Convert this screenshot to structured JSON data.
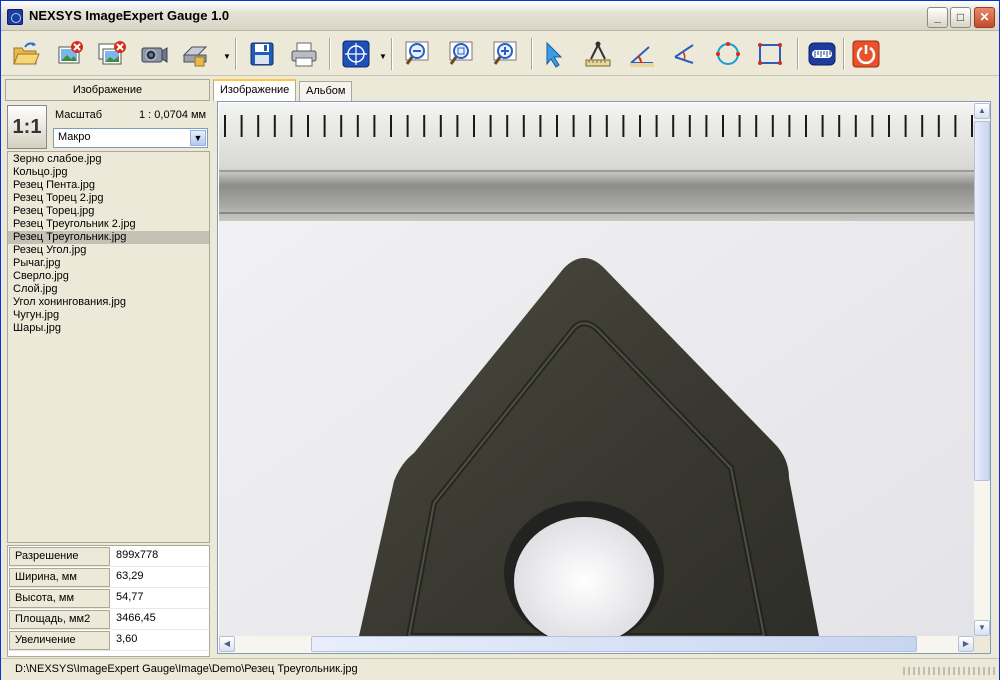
{
  "window": {
    "title": "NEXSYS ImageExpert Gauge 1.0",
    "controls": {
      "minimize": "_",
      "maximize": "□",
      "close": "✕"
    }
  },
  "toolbar": {
    "buttons": [
      {
        "name": "open-folder-icon"
      },
      {
        "name": "close-image-icon"
      },
      {
        "name": "close-all-images-icon"
      },
      {
        "name": "camera-icon"
      },
      {
        "name": "scanner-icon"
      },
      {
        "name": "save-icon"
      },
      {
        "name": "print-icon"
      },
      {
        "name": "crosshair-icon"
      },
      {
        "name": "zoom-out-icon"
      },
      {
        "name": "zoom-fit-icon"
      },
      {
        "name": "zoom-in-icon"
      },
      {
        "name": "pointer-icon"
      },
      {
        "name": "measure-distance-icon"
      },
      {
        "name": "measure-angle-icon"
      },
      {
        "name": "measure-angle-lines-icon"
      },
      {
        "name": "measure-circle-icon"
      },
      {
        "name": "measure-rectangle-icon"
      },
      {
        "name": "scale-ruler-icon"
      },
      {
        "name": "power-icon"
      }
    ]
  },
  "left_panel": {
    "header": "Изображение",
    "scale": {
      "button_label": "1:1",
      "label": "Масштаб",
      "value": "1 : 0,0704 мм",
      "mode": "Макро"
    },
    "files": [
      "Зерно слабое.jpg",
      "Кольцо.jpg",
      "Резец Пента.jpg",
      "Резец Торец 2.jpg",
      "Резец Торец.jpg",
      "Резец Треугольник 2.jpg",
      "Резец Треугольник.jpg",
      "Резец Угол.jpg",
      "Рычаг.jpg",
      "Сверло.jpg",
      "Слой.jpg",
      "Угол хонингования.jpg",
      "Чугун.jpg",
      "Шары.jpg"
    ],
    "selected_file_index": 6,
    "info": [
      {
        "key": "Разрешение",
        "value": "899x778"
      },
      {
        "key": "Ширина, мм",
        "value": "63,29"
      },
      {
        "key": "Высота, мм",
        "value": "54,77"
      },
      {
        "key": "Площадь, мм2",
        "value": "3466,45"
      },
      {
        "key": "Увеличение",
        "value": "3,60"
      }
    ]
  },
  "tabs": [
    {
      "label": "Изображение",
      "active": true
    },
    {
      "label": "Альбом",
      "active": false
    }
  ],
  "status": {
    "path": "D:\\NEXSYS\\ImageExpert Gauge\\Image\\Demo\\Резец Треугольник.jpg"
  },
  "colors": {
    "window_border": "#0831D9",
    "panel_bg": "#ECE9D8",
    "selected_row": "#C4C1B4",
    "tab_highlight": "#FFC73C"
  }
}
